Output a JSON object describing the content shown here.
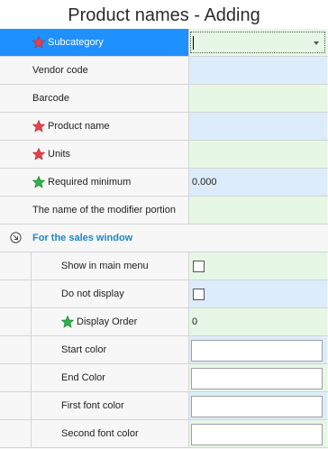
{
  "title": "Product names - Adding",
  "fields": [
    {
      "label": "Subcategory",
      "star": "red",
      "value": "",
      "kind": "combo"
    },
    {
      "label": "Vendor code",
      "star": "",
      "value": "",
      "kind": "text"
    },
    {
      "label": "Barcode",
      "star": "",
      "value": "",
      "kind": "text"
    },
    {
      "label": "Product name",
      "star": "red",
      "value": "",
      "kind": "text"
    },
    {
      "label": "Units",
      "star": "red",
      "value": "",
      "kind": "text"
    },
    {
      "label": "Required minimum",
      "star": "green",
      "value": "0.000",
      "kind": "text"
    },
    {
      "label": "The name of the modifier portion",
      "star": "",
      "value": "",
      "kind": "text"
    }
  ],
  "section": {
    "label": "For the sales window",
    "icon": "collapse-circle-icon",
    "fields": [
      {
        "label": "Show in main menu",
        "star": "",
        "value": "",
        "kind": "checkbox",
        "checked": false
      },
      {
        "label": "Do not display",
        "star": "",
        "value": "",
        "kind": "checkbox",
        "checked": false
      },
      {
        "label": "Display Order",
        "star": "green",
        "value": "0",
        "kind": "text"
      },
      {
        "label": "Start color",
        "star": "",
        "value": "",
        "kind": "color"
      },
      {
        "label": "End Color",
        "star": "",
        "value": "",
        "kind": "color"
      },
      {
        "label": "First font color",
        "star": "",
        "value": "",
        "kind": "color"
      },
      {
        "label": "Second font color",
        "star": "",
        "value": "",
        "kind": "color"
      }
    ]
  },
  "colors": {
    "selection": "#1e90ff",
    "required_star": "#e8404a",
    "optional_star": "#2fb14a",
    "section_text": "#1a86c8"
  }
}
